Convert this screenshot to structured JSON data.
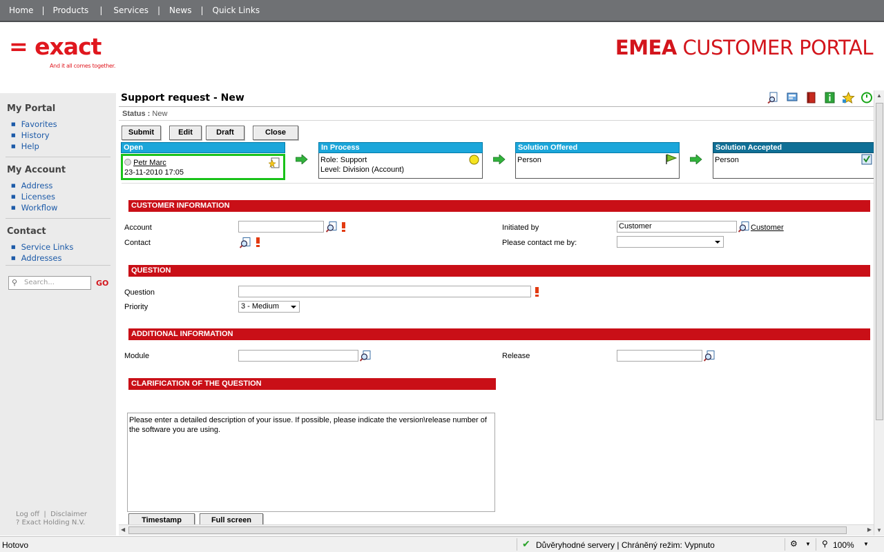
{
  "nav": {
    "items": [
      {
        "label": "Home"
      },
      {
        "label": "Products"
      },
      {
        "label": "Services"
      },
      {
        "label": "News"
      },
      {
        "label": "Quick Links"
      }
    ],
    "separator": "|"
  },
  "header": {
    "logo_text": "= exact",
    "tagline": "And it all comes together.",
    "portal_title_bold": "EMEA",
    "portal_title_rest": "CUSTOMER PORTAL"
  },
  "sidebar": {
    "sections": [
      {
        "title": "My Portal",
        "items": [
          "Favorites",
          "History",
          "Help"
        ]
      },
      {
        "title": "My Account",
        "items": [
          "Address",
          "Licenses",
          "Workflow"
        ]
      },
      {
        "title": "Contact",
        "items": [
          "Service Links",
          "Addresses"
        ]
      }
    ],
    "search_placeholder": "Search...",
    "go_label": "GO",
    "footer_links": "Log off  |  Disclaimer",
    "copyright": "? Exact Holding N.V."
  },
  "page": {
    "title": "Support request - New",
    "status_label": "Status :",
    "status_value": "New"
  },
  "toolbar": {
    "icons": [
      "search-document-icon",
      "screen-icon",
      "book-icon",
      "info-icon",
      "favorite-icon",
      "refresh-icon"
    ],
    "buttons": {
      "submit": "Submit",
      "edit": "Edit",
      "draft": "Draft",
      "close": "Close"
    }
  },
  "workflow": {
    "stages": [
      {
        "name": "Open",
        "user": "Petr Marc",
        "datetime": "23-11-2010 17:05"
      },
      {
        "name": "In Process",
        "line1": "Role: Support",
        "line2": "Level: Division (Account)"
      },
      {
        "name": "Solution Offered",
        "line1": "Person"
      },
      {
        "name": "Solution Accepted",
        "line1": "Person"
      }
    ]
  },
  "form": {
    "customer_info": {
      "title": "CUSTOMER INFORMATION",
      "account_label": "Account",
      "account_value": "",
      "contact_label": "Contact",
      "initiated_by_label": "Initiated by",
      "initiated_by_value": "Customer",
      "initiated_by_link": "Customer",
      "contact_me_label": "Please contact me by:",
      "contact_me_value": ""
    },
    "question": {
      "title": "QUESTION",
      "question_label": "Question",
      "question_value": "",
      "priority_label": "Priority",
      "priority_value": "3 - Medium"
    },
    "additional": {
      "title": "ADDITIONAL INFORMATION",
      "module_label": "Module",
      "module_value": "",
      "release_label": "Release",
      "release_value": ""
    },
    "clarification": {
      "title": "CLARIFICATION OF THE QUESTION",
      "text": "Please enter a detailed description of your issue. If possible, please indicate the version\\release number of the software you are using.",
      "timestamp_button": "Timestamp",
      "fullscreen_button": "Full screen"
    }
  },
  "statusbar": {
    "left": "Hotovo",
    "trust": "Důvěryhodné servery | Chráněný režim: Vypnuto",
    "zoom": "100%"
  },
  "colors": {
    "brand_red": "#e0171e",
    "section_red": "#c90f17",
    "stage_blue": "#1ba6da",
    "link_blue": "#1c5aa8",
    "highlight_green": "#19c219"
  }
}
